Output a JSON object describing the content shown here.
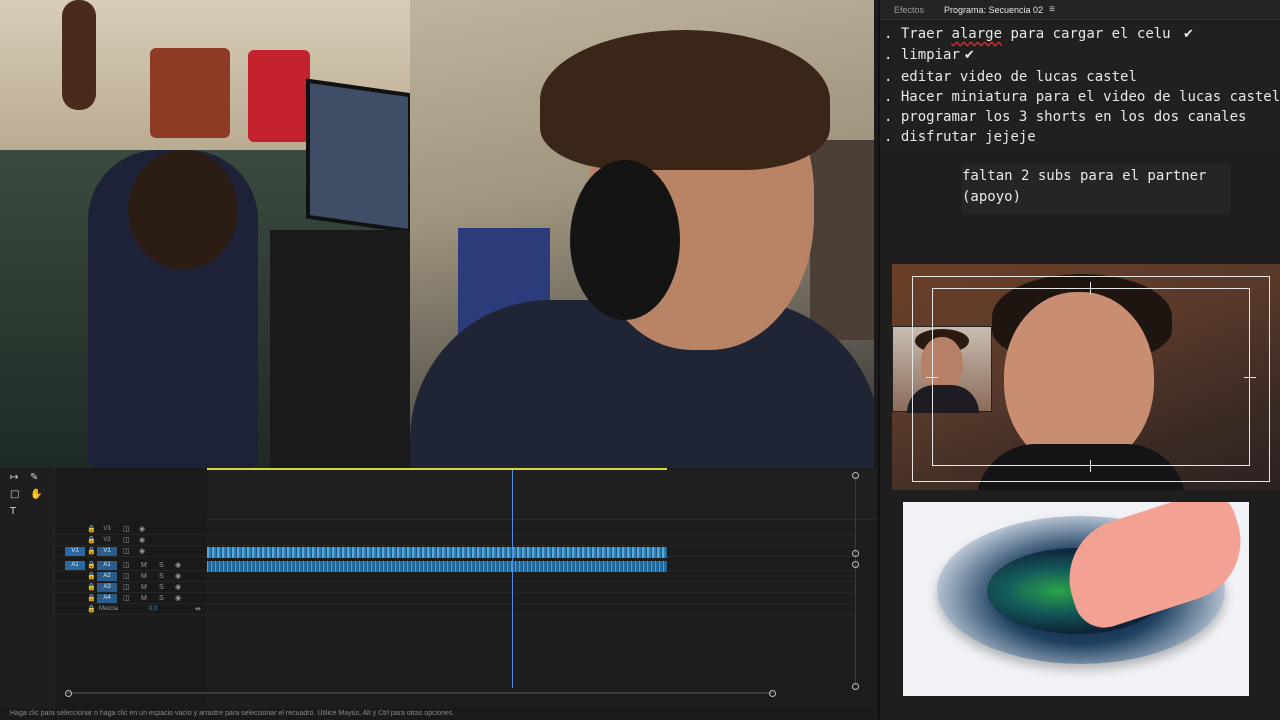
{
  "right_panel": {
    "tabs": [
      "Efectos",
      "Programa: Secuencia 02"
    ],
    "menu_icon": "hamburger-menu-icon",
    "notes": [
      {
        "bullet": ".",
        "pre": "Traer ",
        "underlined": "alarge",
        "post": " para cargar el celu",
        "check": "✔"
      },
      {
        "bullet": ".",
        "pre": "limpiar",
        "underlined": "",
        "post": "",
        "check": "✔"
      },
      {
        "bullet": ".",
        "pre": "editar video de lucas castel",
        "underlined": "",
        "post": "",
        "check": ""
      },
      {
        "bullet": ".",
        "pre": "Hacer miniatura para el video de lucas castel",
        "underlined": "",
        "post": "",
        "check": ""
      },
      {
        "bullet": ".",
        "pre": "programar los 3 shorts en los dos canales",
        "underlined": "",
        "post": "",
        "check": ""
      },
      {
        "bullet": ".",
        "pre": "disfrutar jejeje",
        "underlined": "",
        "post": "",
        "check": ""
      }
    ],
    "note_box": [
      "faltan 2 subs para el partner",
      "(apoyo)"
    ]
  },
  "timeline": {
    "tools": [
      "ripple-edit-icon",
      "pen-icon",
      "rectangle-icon",
      "hand-icon",
      "type-icon"
    ],
    "tracks": [
      {
        "name": "V3",
        "source": "",
        "type": "video"
      },
      {
        "name": "V2",
        "source": "",
        "type": "video"
      },
      {
        "name": "V1",
        "source": "V1",
        "type": "video"
      },
      {
        "name": "A1",
        "source": "A1",
        "type": "audio"
      },
      {
        "name": "A2",
        "source": "",
        "type": "audio"
      },
      {
        "name": "A3",
        "source": "",
        "type": "audio"
      },
      {
        "name": "A4",
        "source": "",
        "type": "audio"
      }
    ],
    "toggles": {
      "mute": "M",
      "solo": "S"
    },
    "mix": {
      "label": "Mezcla",
      "value": "0,0"
    }
  },
  "status_bar": "Haga clic para seleccionar o haga clic en un espacio vacío y arrastre para seleccionar el recuadro. Utilice Mayús, Alt y Ctrl para otras opciones.",
  "colors": {
    "panel_bg": "#1e1e1e",
    "track_target": "#2b6aa0",
    "clip_video": "#5aa9d6",
    "playhead": "#4f8fe0",
    "work_area": "#d9d93a"
  }
}
